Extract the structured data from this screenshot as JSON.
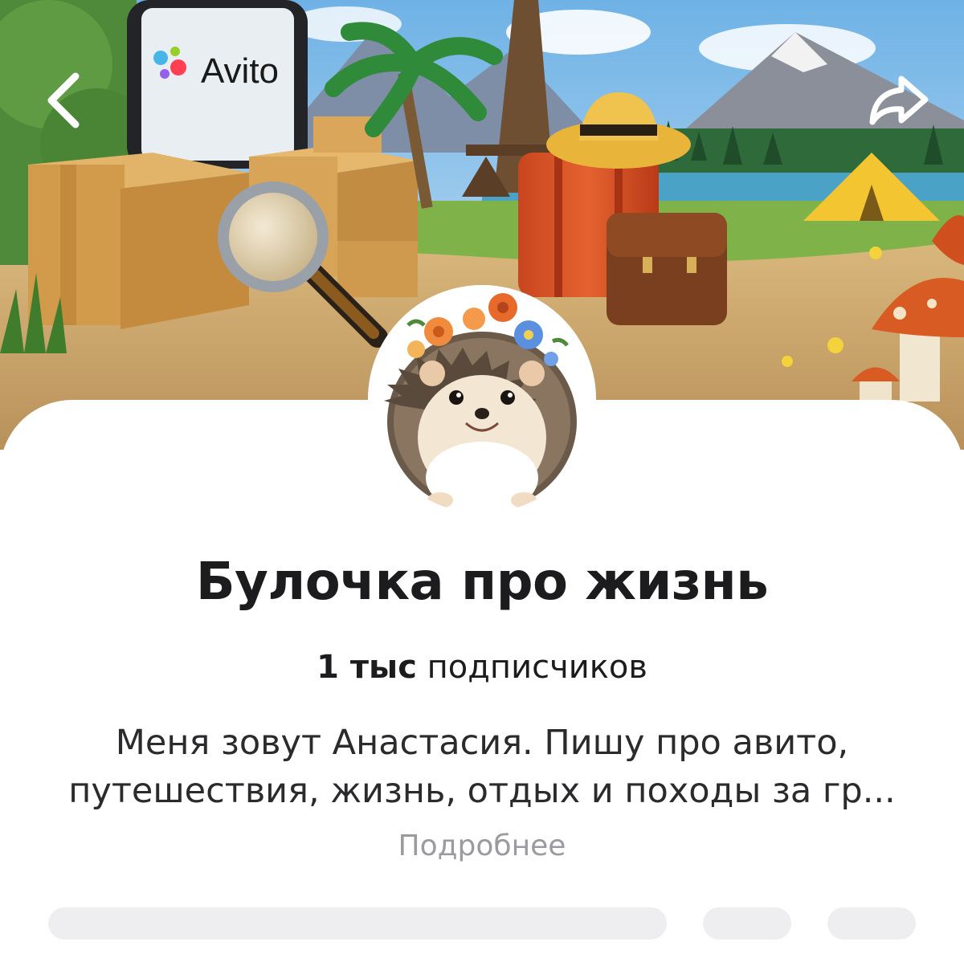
{
  "channel": {
    "title": "Булочка про жизнь",
    "subscribers_count": "1 тыс",
    "subscribers_label": "подписчиков",
    "description": "Меня зовут Анастасия. Пишу про авито, путешествия, жизнь, отдых и походы за гр...",
    "more_label": "Подробнее"
  },
  "cover": {
    "phone_brand": "Avito"
  },
  "icons": {
    "back": "back-chevron-icon",
    "share": "share-arrow-icon"
  },
  "colors": {
    "title": "#1c1c1e",
    "more": "#9a9aa0",
    "background": "#ffffff"
  }
}
